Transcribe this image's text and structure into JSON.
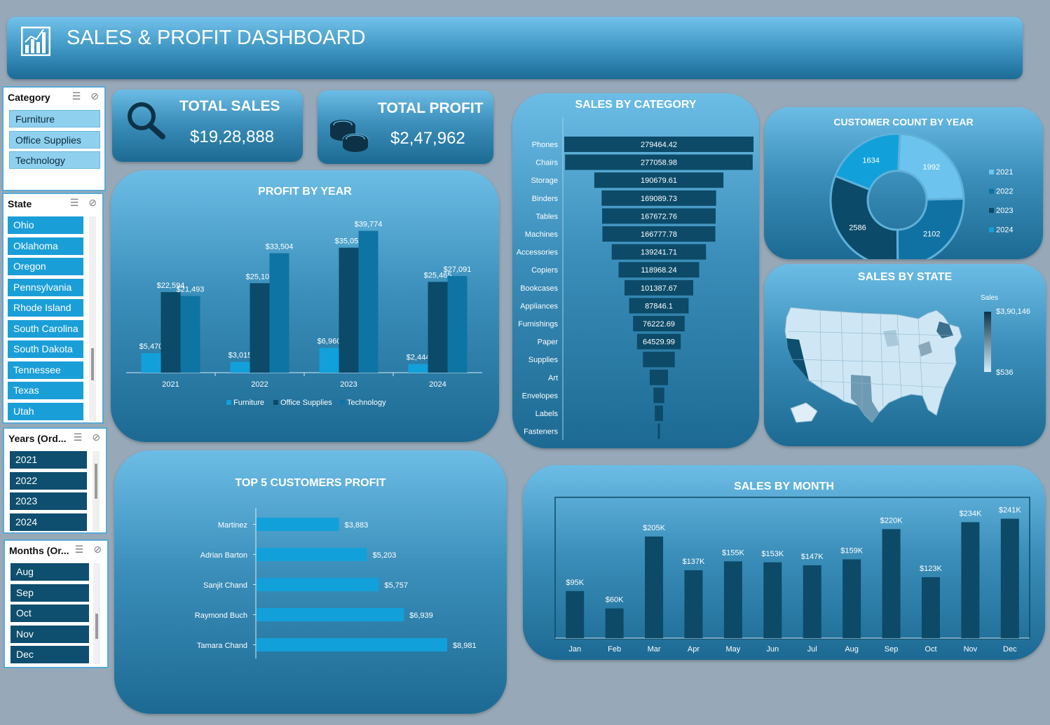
{
  "header": {
    "title": "SALES & PROFIT DASHBOARD",
    "icon": "bar-chart-icon"
  },
  "slicers": {
    "category": {
      "label": "Category",
      "items": [
        "Furniture",
        "Office Supplies",
        "Technology"
      ]
    },
    "state": {
      "label": "State",
      "items": [
        "Ohio",
        "Oklahoma",
        "Oregon",
        "Pennsylvania",
        "Rhode Island",
        "South Carolina",
        "South Dakota",
        "Tennessee",
        "Texas",
        "Utah"
      ]
    },
    "years": {
      "label": "Years (Ord...",
      "items": [
        "2021",
        "2022",
        "2023",
        "2024"
      ]
    },
    "months": {
      "label": "Months (Or...",
      "items": [
        "Aug",
        "Sep",
        "Oct",
        "Nov",
        "Dec"
      ]
    }
  },
  "kpis": {
    "total_sales": {
      "label": "TOTAL SALES",
      "value": "$19,28,888",
      "icon": "search-icon"
    },
    "total_profit": {
      "label": "TOTAL PROFIT",
      "value": "$2,47,962",
      "icon": "coins-icon"
    }
  },
  "colors": {
    "furniture": "#12a0da",
    "office": "#0b4a69",
    "technology": "#0e74a3",
    "dark_bar": "#0c4a68"
  },
  "chart_data": [
    {
      "id": "profit_by_year",
      "type": "bar",
      "title": "PROFIT BY YEAR",
      "categories": [
        "2021",
        "2022",
        "2023",
        "2024"
      ],
      "series": [
        {
          "name": "Furniture",
          "values": [
            5470,
            3015,
            6960,
            2444
          ],
          "labels": [
            "$5,470",
            "$3,015",
            "$6,960",
            "$2,444"
          ]
        },
        {
          "name": "Office Supplies",
          "values": [
            22594,
            25100,
            35053,
            25465
          ],
          "labels": [
            "$22,594",
            "$25,100",
            "$35,053",
            "$25,465"
          ]
        },
        {
          "name": "Technology",
          "values": [
            21493,
            33504,
            39774,
            27091
          ],
          "labels": [
            "$21,493",
            "$33,504",
            "$39,774",
            "$27,091"
          ]
        }
      ],
      "legend": "bottom",
      "ylim": [
        0,
        45000
      ]
    },
    {
      "id": "sales_by_category",
      "type": "bar",
      "orientation": "horizontal-funnel",
      "title": "SALES BY CATEGORY",
      "categories": [
        "Phones",
        "Chairs",
        "Storage",
        "Binders",
        "Tables",
        "Machines",
        "Accessories",
        "Copiers",
        "Bookcases",
        "Appliances",
        "Furnishings",
        "Paper",
        "Supplies",
        "Art",
        "Envelopes",
        "Labels",
        "Fasteners"
      ],
      "values": [
        279464.42,
        277058.98,
        190679.61,
        169089.73,
        167672.76,
        166777.78,
        139241.71,
        118968.24,
        101387.67,
        87846.1,
        76222.69,
        64529.99,
        47000,
        27000,
        16000,
        12000,
        3000
      ],
      "labels": [
        "279464.42",
        "277058.98",
        "190679.61",
        "169089.73",
        "167672.76",
        "166777.78",
        "139241.71",
        "118968.24",
        "101387.67",
        "87846.1",
        "76222.69",
        "64529.99",
        "",
        "",
        "",
        "",
        ""
      ]
    },
    {
      "id": "customer_count_by_year",
      "type": "pie",
      "variant": "donut",
      "title": "CUSTOMER COUNT BY YEAR",
      "categories": [
        "2021",
        "2022",
        "2023",
        "2024"
      ],
      "values": [
        1992,
        2102,
        2586,
        1634
      ],
      "labels": [
        "1992",
        "2102",
        "2586",
        "1634"
      ],
      "colors": [
        "#6cc4ee",
        "#0f72a2",
        "#0b4a69",
        "#12a0da"
      ],
      "legend": "right"
    },
    {
      "id": "sales_by_state",
      "type": "heatmap",
      "variant": "map",
      "title": "SALES BY STATE",
      "legend_title": "Sales",
      "max_label": "$3,90,146",
      "min_label": "$536"
    },
    {
      "id": "top5_customers_profit",
      "type": "bar",
      "orientation": "horizontal",
      "title": "TOP 5 CUSTOMERS PROFIT",
      "categories": [
        "Martinez",
        "Adrian Barton",
        "Sanjit Chand",
        "Raymond Buch",
        "Tamara Chand"
      ],
      "values": [
        3883,
        5203,
        5757,
        6939,
        8981
      ],
      "labels": [
        "$3,883",
        "$5,203",
        "$5,757",
        "$6,939",
        "$8,981"
      ],
      "xlim": [
        0,
        10000
      ]
    },
    {
      "id": "sales_by_month",
      "type": "bar",
      "title": "SALES BY MONTH",
      "categories": [
        "Jan",
        "Feb",
        "Mar",
        "Apr",
        "May",
        "Jun",
        "Jul",
        "Aug",
        "Sep",
        "Oct",
        "Nov",
        "Dec"
      ],
      "values": [
        95,
        60,
        205,
        137,
        155,
        153,
        147,
        159,
        220,
        123,
        234,
        241
      ],
      "labels": [
        "$95K",
        "$60K",
        "$205K",
        "$137K",
        "$155K",
        "$153K",
        "$147K",
        "$159K",
        "$220K",
        "$123K",
        "$234K",
        "$241K"
      ],
      "ylim": [
        0,
        270
      ]
    }
  ]
}
